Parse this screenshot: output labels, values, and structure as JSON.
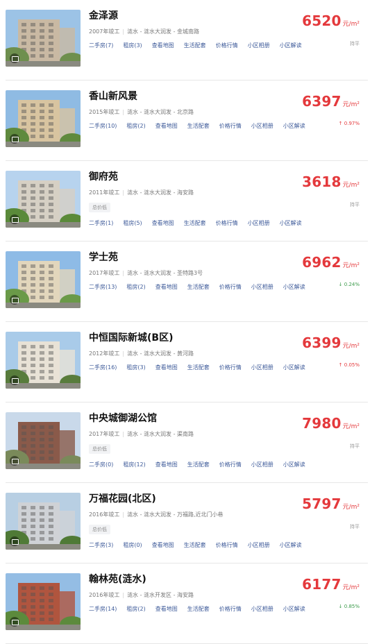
{
  "colors": {
    "accent": "#e4393c",
    "link": "#3d5a99",
    "down": "#3a9a4a",
    "tag_bg": "#f2f3f5"
  },
  "items": [
    {
      "name": "金泽源",
      "year": "2007年竣工",
      "district": "涟水 - 涟水大润发 - 金城南路",
      "tag": "",
      "links": [
        "二手房(7)",
        "租房(3)",
        "查看地图",
        "生活配套",
        "价格行情",
        "小区相册",
        "小区解读"
      ],
      "price": "6520",
      "unit": "元/m²",
      "trend": "持平",
      "trend_dir": "flat",
      "photo_icon": "camera-icon"
    },
    {
      "name": "香山新风景",
      "year": "2015年竣工",
      "district": "涟水 - 涟水大润发 - 北京路",
      "tag": "",
      "links": [
        "二手房(10)",
        "租房(2)",
        "查看地图",
        "生活配套",
        "价格行情",
        "小区相册",
        "小区解读"
      ],
      "price": "6397",
      "unit": "元/m²",
      "trend": "↑ 0.97%",
      "trend_dir": "up",
      "photo_icon": "camera-icon"
    },
    {
      "name": "御府苑",
      "year": "2011年竣工",
      "district": "涟水 - 涟水大润发 - 海安路",
      "tag": "总价低",
      "links": [
        "二手房(1)",
        "租房(5)",
        "查看地图",
        "生活配套",
        "价格行情",
        "小区相册",
        "小区解读"
      ],
      "price": "3618",
      "unit": "元/m²",
      "trend": "持平",
      "trend_dir": "flat",
      "photo_icon": "camera-icon"
    },
    {
      "name": "学士苑",
      "year": "2017年竣工",
      "district": "涟水 - 涟水大润发 - 圣特路3号",
      "tag": "",
      "links": [
        "二手房(13)",
        "租房(2)",
        "查看地图",
        "生活配套",
        "价格行情",
        "小区相册",
        "小区解读"
      ],
      "price": "6962",
      "unit": "元/m²",
      "trend": "↓ 0.24%",
      "trend_dir": "down",
      "photo_icon": "camera-icon"
    },
    {
      "name": "中恒国际新城(B区)",
      "year": "2012年竣工",
      "district": "涟水 - 涟水大润发 - 黄河路",
      "tag": "",
      "links": [
        "二手房(16)",
        "租房(3)",
        "查看地图",
        "生活配套",
        "价格行情",
        "小区相册",
        "小区解读"
      ],
      "price": "6399",
      "unit": "元/m²",
      "trend": "↑ 0.05%",
      "trend_dir": "up",
      "photo_icon": "camera-icon"
    },
    {
      "name": "中央城御湖公馆",
      "year": "2017年竣工",
      "district": "涟水 - 涟水大润发 - 渠南路",
      "tag": "总价低",
      "links": [
        "二手房(0)",
        "租房(12)",
        "查看地图",
        "生活配套",
        "价格行情",
        "小区相册",
        "小区解读"
      ],
      "price": "7980",
      "unit": "元/m²",
      "trend": "持平",
      "trend_dir": "flat",
      "photo_icon": "camera-icon"
    },
    {
      "name": "万福花园(北区)",
      "year": "2016年竣工",
      "district": "涟水 - 涟水大润发 - 万福路,近北门小巷",
      "tag": "总价低",
      "links": [
        "二手房(3)",
        "租房(0)",
        "查看地图",
        "生活配套",
        "价格行情",
        "小区相册",
        "小区解读"
      ],
      "price": "5797",
      "unit": "元/m²",
      "trend": "持平",
      "trend_dir": "flat",
      "photo_icon": "camera-icon"
    },
    {
      "name": "翰林苑(涟水)",
      "year": "2016年竣工",
      "district": "涟水 - 涟水开发区 - 海安路",
      "tag": "",
      "links": [
        "二手房(14)",
        "租房(2)",
        "查看地图",
        "生活配套",
        "价格行情",
        "小区相册",
        "小区解读"
      ],
      "price": "6177",
      "unit": "元/m²",
      "trend": "↓ 0.85%",
      "trend_dir": "down",
      "photo_icon": "camera-icon"
    }
  ]
}
